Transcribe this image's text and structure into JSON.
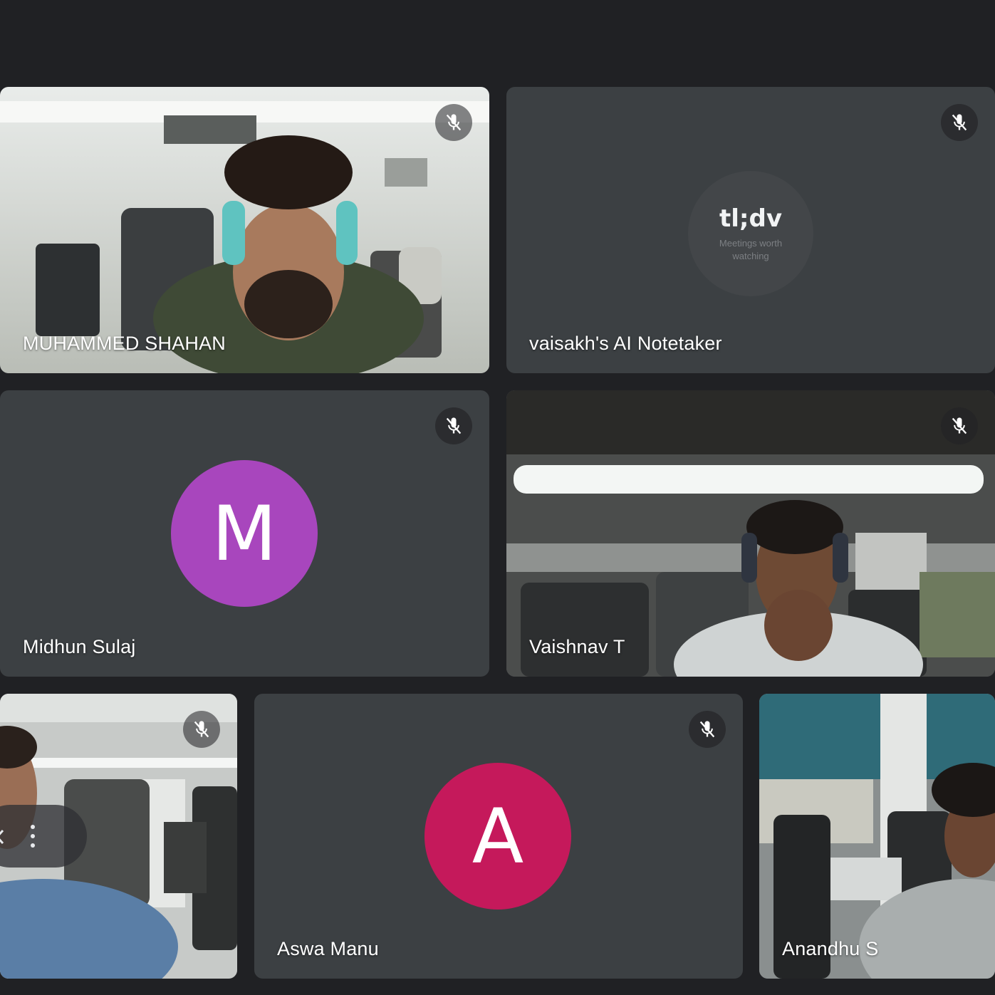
{
  "participants": [
    {
      "name": "MUHAMMED SHAHAN",
      "kind": "video",
      "muted": true
    },
    {
      "name": "vaisakh's AI Notetaker",
      "kind": "notetaker",
      "muted": true
    },
    {
      "name": "Midhun Sulaj",
      "kind": "avatar",
      "initial": "M",
      "avatar_color": "#a846bd",
      "muted": true
    },
    {
      "name": "Vaishnav T",
      "kind": "video",
      "muted": true
    },
    {
      "name": "",
      "kind": "video",
      "muted": true
    },
    {
      "name": "Aswa Manu",
      "kind": "avatar",
      "initial": "A",
      "avatar_color": "#c5195b",
      "muted": true
    },
    {
      "name": "Anandhu S",
      "kind": "video",
      "muted": false
    }
  ],
  "notetaker_logo": {
    "title": "tl;dv",
    "subtitle": "Meetings worth watching"
  },
  "icons": {
    "mute": "mic-off-icon",
    "more": "more-vert-icon",
    "collapse": "chevron-left-icon"
  },
  "colors": {
    "background": "#202124",
    "tile": "#3c4043"
  }
}
